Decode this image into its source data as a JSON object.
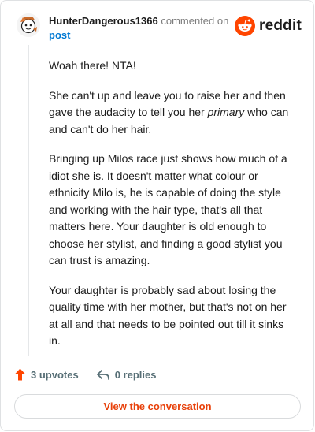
{
  "comment": {
    "username": "HunterDangerous1366",
    "action_text": "commented on",
    "post_link_text": "post",
    "paragraphs": [
      {
        "text": "Woah there! NTA!"
      },
      {
        "before": "She can't up and leave you to raise her and then gave the audacity to tell you her ",
        "emphasis": "primary",
        "after": " who can and can't do her hair."
      },
      {
        "text": "Bringing up Milos race just shows how much of a idiot she is. It doesn't matter what colour or ethnicity Milo is, he is capable of doing the style and working with the hair type, that's all that matters here. Your daughter is old enough to choose her stylist, and finding a good stylist you can trust is amazing."
      },
      {
        "text": "Your daughter is probably sad about losing the quality time with her mother, but that's not on her at all and that needs to be pointed out till it sinks in."
      }
    ]
  },
  "brand": {
    "name": "reddit",
    "color": "#ff4500"
  },
  "footer": {
    "upvotes_label": "3 upvotes",
    "replies_label": "0 replies",
    "upvote_icon": "upvote-arrow-icon",
    "reply_icon": "reply-arrow-icon"
  },
  "view_button": {
    "label": "View the conversation"
  },
  "colors": {
    "accent": "#ff4500",
    "link": "#0079d3",
    "muted": "#576f76"
  }
}
